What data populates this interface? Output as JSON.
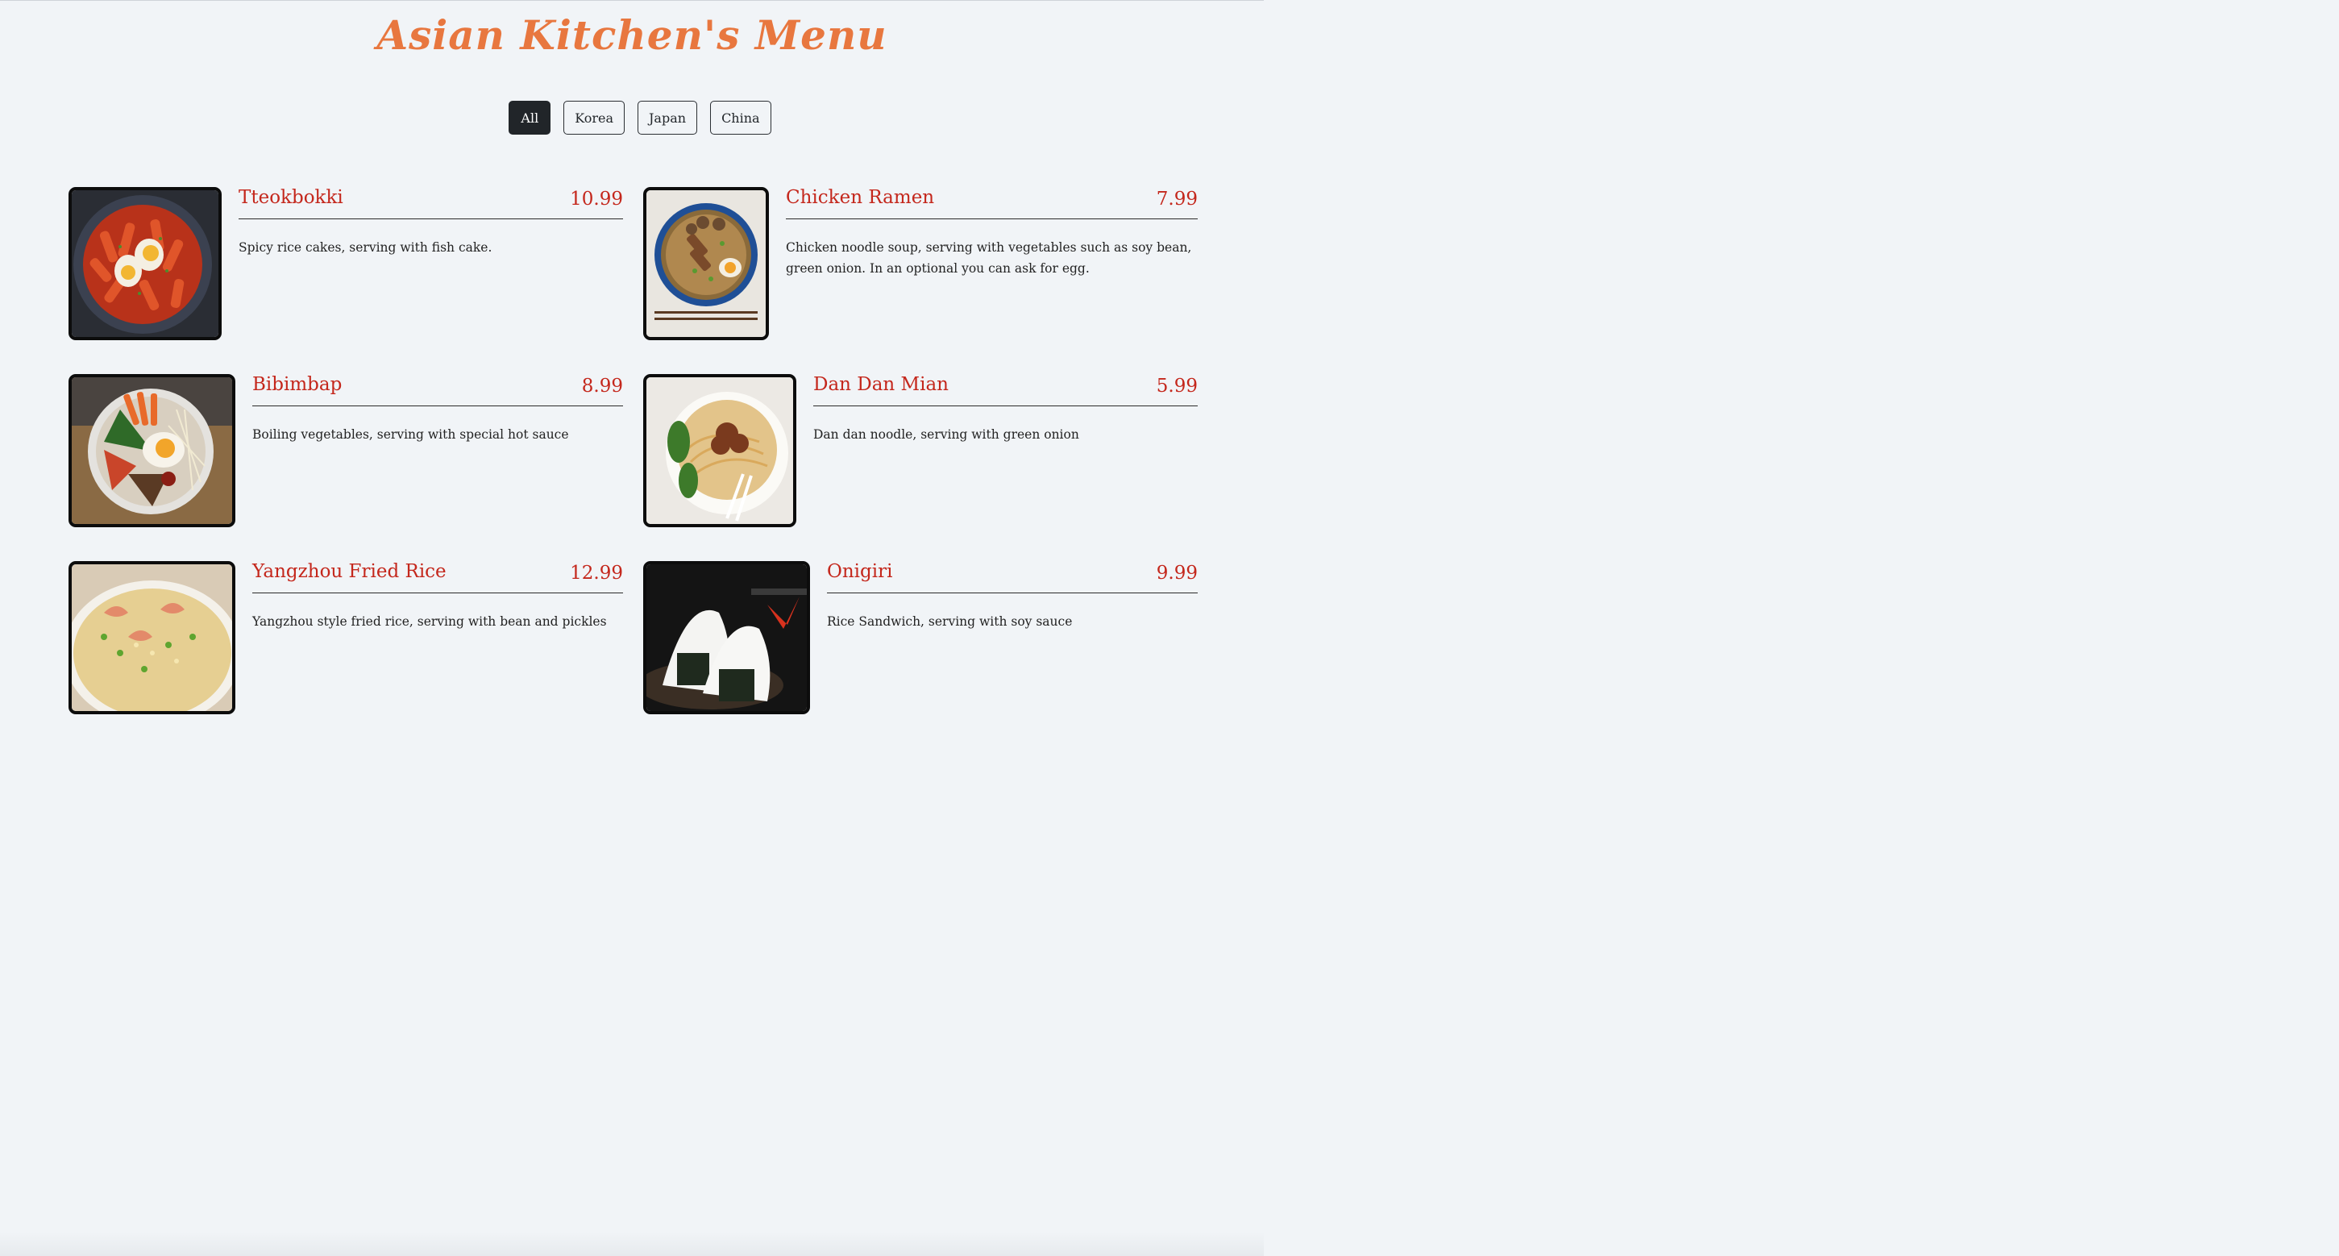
{
  "title": "Asian Kitchen's Menu",
  "filters": [
    {
      "label": "All",
      "active": true
    },
    {
      "label": "Korea",
      "active": false
    },
    {
      "label": "Japan",
      "active": false
    },
    {
      "label": "China",
      "active": false
    }
  ],
  "items": [
    {
      "name": "Tteokbokki",
      "price": "10.99",
      "desc": "Spicy rice cakes, serving with fish cake.",
      "photo": "tteokbokki-photo"
    },
    {
      "name": "Chicken Ramen",
      "price": "7.99",
      "desc": "Chicken noodle soup, serving with vegetables such as soy bean, green onion. In an optional you can ask for egg.",
      "photo": "chicken-ramen-photo"
    },
    {
      "name": "Bibimbap",
      "price": "8.99",
      "desc": "Boiling vegetables, serving with special hot sauce",
      "photo": "bibimbap-photo"
    },
    {
      "name": "Dan Dan Mian",
      "price": "5.99",
      "desc": "Dan dan noodle, serving with green onion",
      "photo": "dan-dan-mian-photo"
    },
    {
      "name": "Yangzhou Fried Rice",
      "price": "12.99",
      "desc": "Yangzhou style fried rice, serving with bean and pickles",
      "photo": "yangzhou-fried-rice-photo"
    },
    {
      "name": "Onigiri",
      "price": "9.99",
      "desc": "Rice Sandwich, serving with soy sauce",
      "photo": "onigiri-photo"
    }
  ],
  "colors": {
    "title": "#e8773f",
    "accent_red": "#c4271c",
    "background": "#f1f4f7",
    "active_filter": "#212529"
  }
}
